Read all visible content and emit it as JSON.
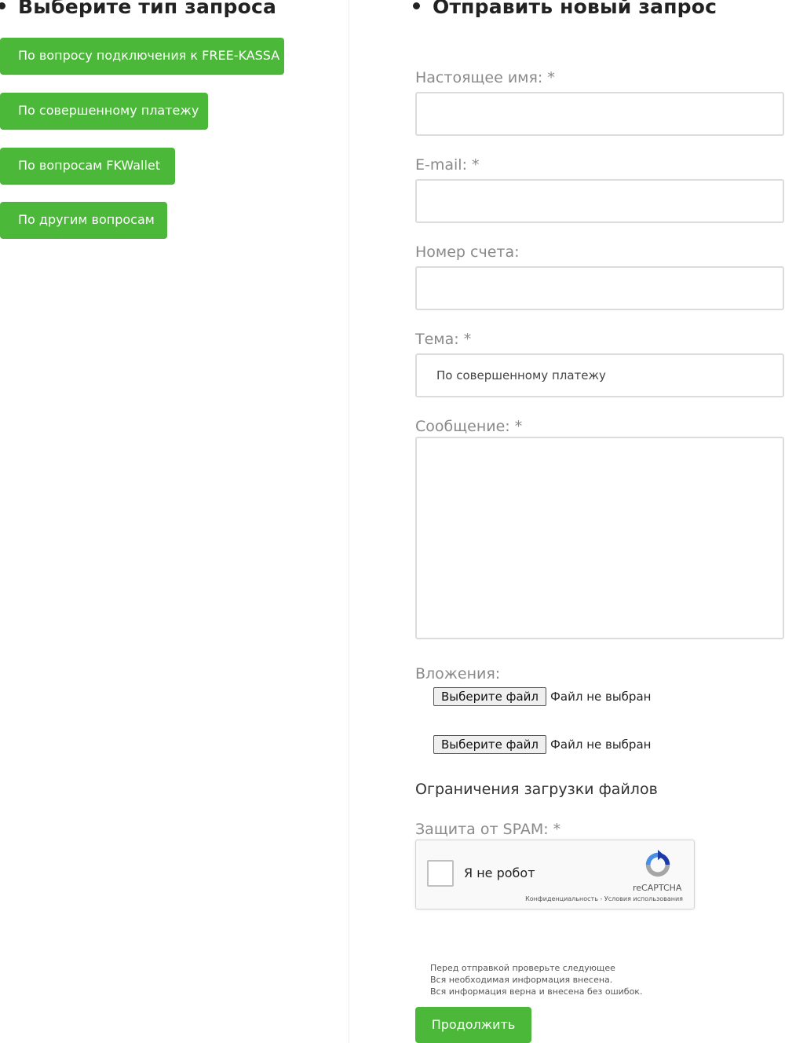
{
  "left": {
    "title": "Выберите тип запроса",
    "buttons": [
      "По вопросу подключения к FREE-KASSA",
      "По совершенному платежу",
      "По вопросам FKWallet",
      "По другим вопросам"
    ]
  },
  "form": {
    "title": "Отправить новый запрос",
    "name_label": "Настоящее имя: *",
    "name_value": "",
    "email_label": "E-mail: *",
    "email_value": "",
    "account_label": "Номер счета:",
    "account_value": "",
    "subject_label": "Тема: *",
    "subject_value": "По совершенному платежу",
    "message_label": "Сообщение: *",
    "message_value": "",
    "attachments_label": "Вложения:",
    "file_button": "Выберите файл",
    "file_status": "Файл не выбран",
    "limits_text": "Ограничения загрузки файлов",
    "spam_label": "Защита от SPAM: *",
    "captcha": {
      "checkbox_label": "Я не робот",
      "brand": "reCAPTCHA",
      "terms": "Конфиденциальность - Условия использования"
    },
    "notes": [
      "Перед отправкой проверьте следующее",
      "Вся необходимая информация внесена.",
      "Вся информация верна и внесена без ошибок."
    ],
    "submit_label": "Продолжить"
  },
  "colors": {
    "accent": "#4cb83a",
    "label": "#8a8a8a",
    "border": "#dcdcdc"
  }
}
